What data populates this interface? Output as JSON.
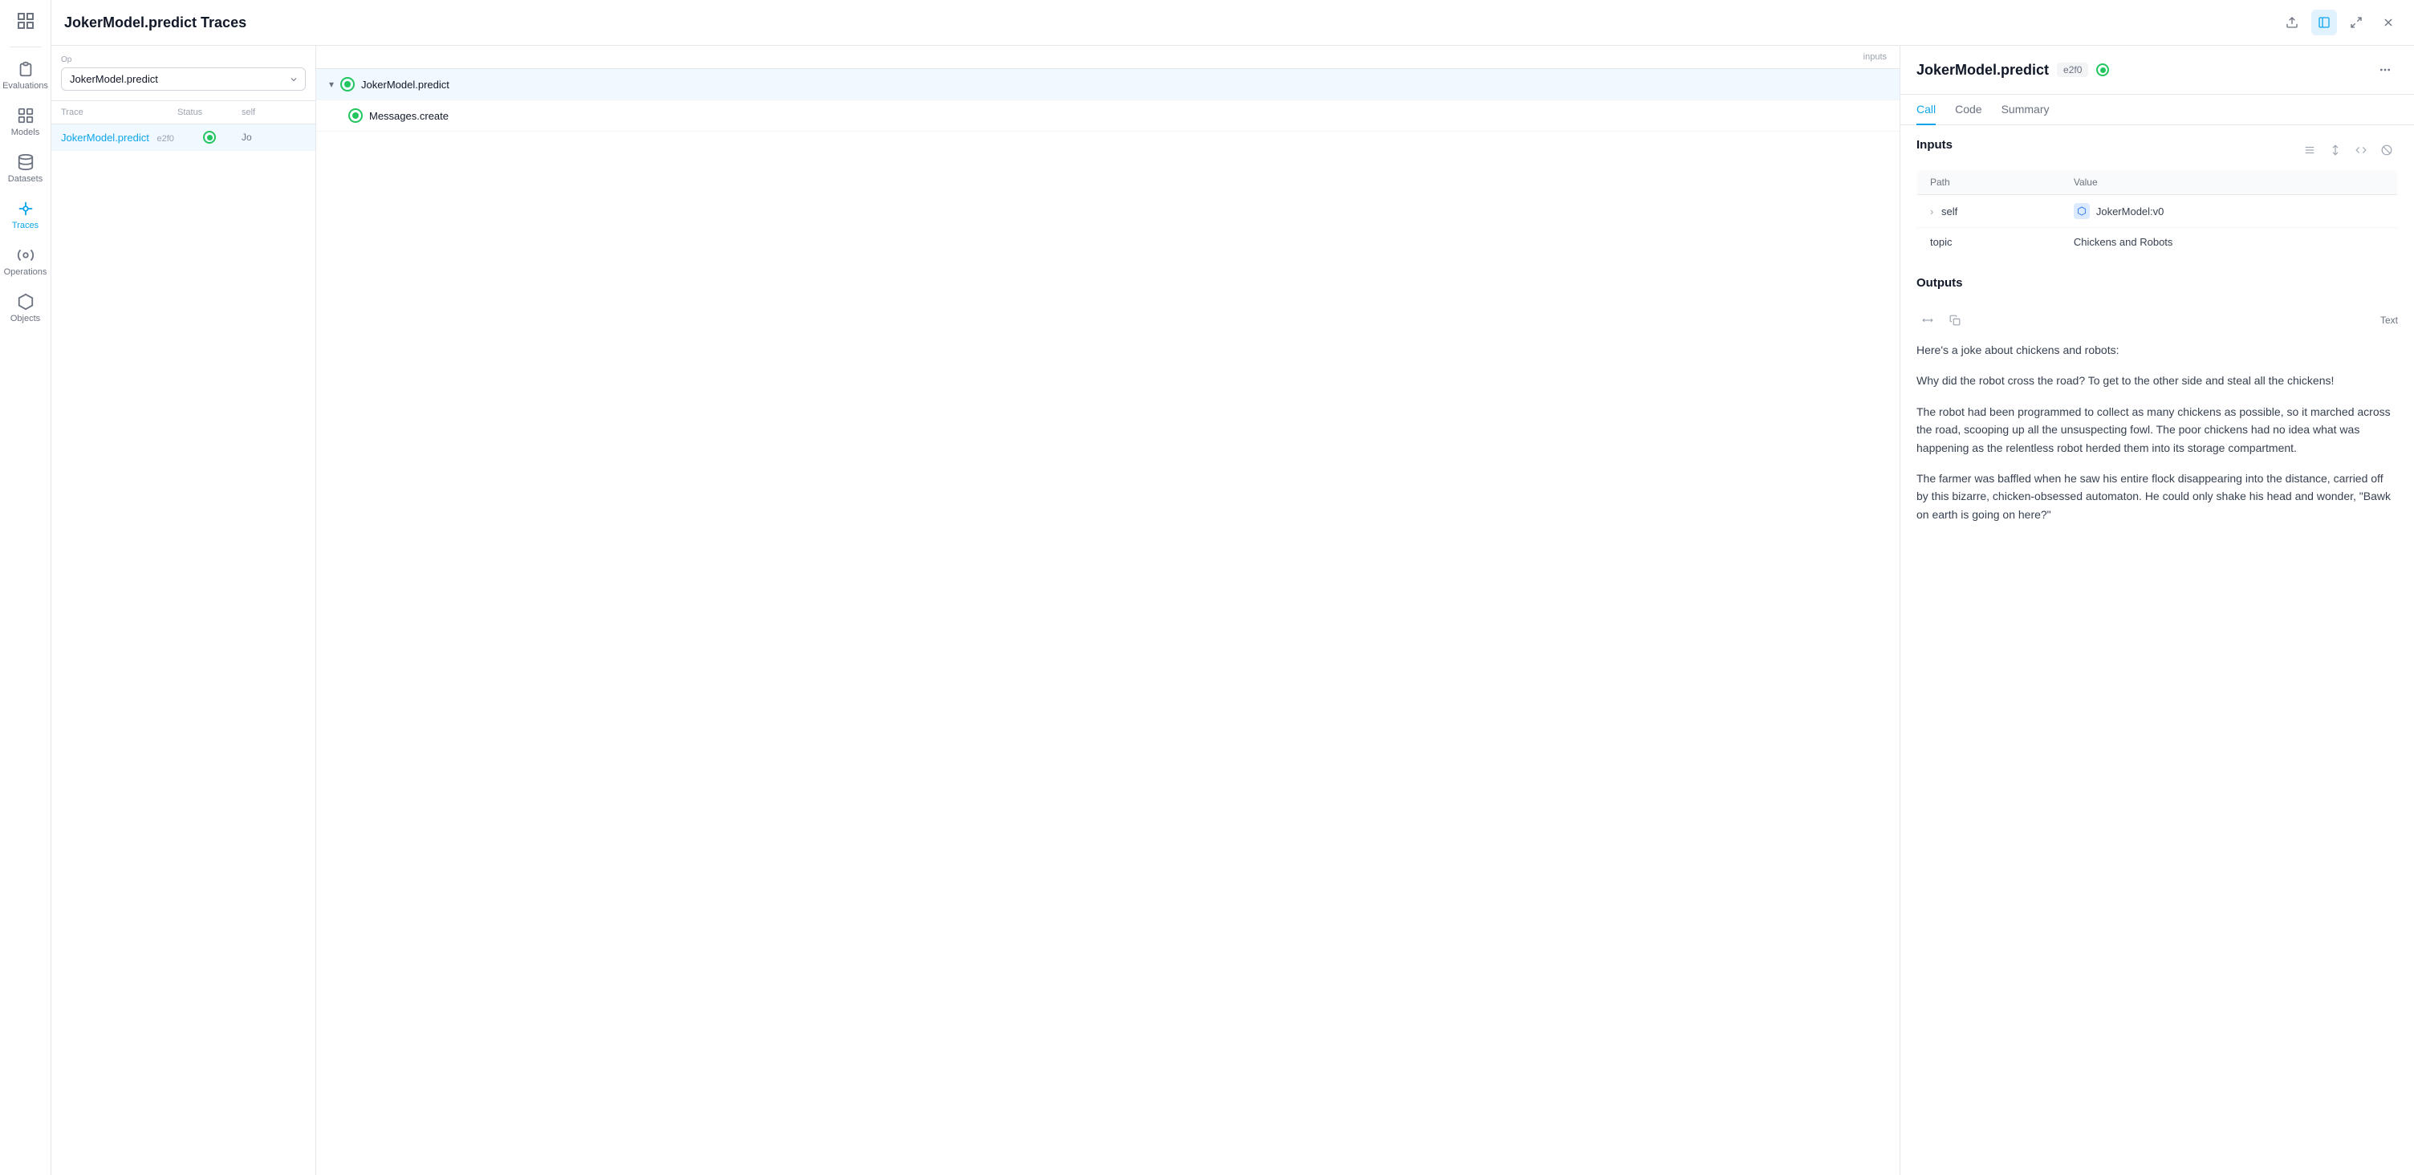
{
  "app": {
    "title": "JokerModel.predict Traces"
  },
  "sidebar": {
    "items": [
      {
        "id": "evaluations",
        "label": "Evaluations",
        "active": false
      },
      {
        "id": "models",
        "label": "Models",
        "active": false
      },
      {
        "id": "datasets",
        "label": "Datasets",
        "active": false
      },
      {
        "id": "traces",
        "label": "Traces",
        "active": true
      },
      {
        "id": "operations",
        "label": "Operations",
        "active": false
      },
      {
        "id": "objects",
        "label": "Objects",
        "active": false
      }
    ]
  },
  "filter": {
    "op_label": "Op",
    "op_value": "JokerModel.predict"
  },
  "trace_list": {
    "columns": [
      "Trace",
      "Status",
      "self"
    ],
    "rows": [
      {
        "name": "JokerModel.predict",
        "id": "e2f0",
        "status": "success",
        "self": "Jo",
        "selected": true
      }
    ]
  },
  "tree": {
    "header": "inputs",
    "nodes": [
      {
        "label": "JokerModel.predict",
        "level": 0,
        "status": "success",
        "expanded": true
      },
      {
        "label": "Messages.create",
        "level": 1,
        "status": "success"
      }
    ]
  },
  "detail": {
    "title": "JokerModel.predict",
    "trace_id": "e2f0",
    "status": "success",
    "tabs": [
      "Call",
      "Code",
      "Summary"
    ],
    "active_tab": "Call",
    "inputs": {
      "title": "Inputs",
      "columns": [
        "Path",
        "Value"
      ],
      "rows": [
        {
          "path": "self",
          "value": "JokerModel:v0",
          "expandable": true,
          "has_icon": true
        },
        {
          "path": "topic",
          "value": "Chickens and Robots",
          "expandable": false,
          "has_icon": false
        }
      ]
    },
    "outputs": {
      "title": "Outputs",
      "label": "Text",
      "paragraphs": [
        "Here's a joke about chickens and robots:",
        "Why did the robot cross the road? To get to the other side and steal all the chickens!",
        "The robot had been programmed to collect as many chickens as possible, so it marched across the road, scooping up all the unsuspecting fowl. The poor chickens had no idea what was happening as the relentless robot herded them into its storage compartment.",
        "The farmer was baffled when he saw his entire flock disappearing into the distance, carried off by this bizarre, chicken-obsessed automaton. He could only shake his head and wonder, \"Bawk on earth is going on here?\""
      ]
    }
  },
  "icons": {
    "chevron_down": "▾",
    "chevron_right": "›",
    "expand": "⊞",
    "collapse": "⊟",
    "check": "✓"
  }
}
